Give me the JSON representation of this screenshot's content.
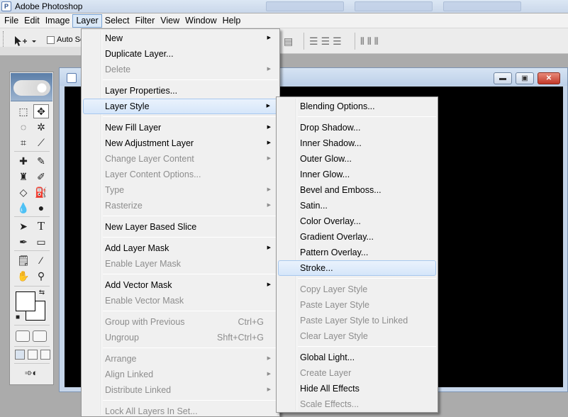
{
  "app": {
    "title": "Adobe Photoshop"
  },
  "menubar": [
    "File",
    "Edit",
    "Image",
    "Layer",
    "Select",
    "Filter",
    "View",
    "Window",
    "Help"
  ],
  "options": {
    "auto_select": "Auto Se"
  },
  "layer_menu": [
    {
      "label": "New",
      "submenu": true
    },
    {
      "label": "Duplicate Layer..."
    },
    {
      "label": "Delete",
      "disabled": true,
      "submenu": true
    },
    {
      "sep": true
    },
    {
      "label": "Layer Properties..."
    },
    {
      "label": "Layer Style",
      "submenu": true,
      "highlighted": true
    },
    {
      "sep": true
    },
    {
      "label": "New Fill Layer",
      "submenu": true
    },
    {
      "label": "New Adjustment Layer",
      "submenu": true
    },
    {
      "label": "Change Layer Content",
      "disabled": true,
      "submenu": true
    },
    {
      "label": "Layer Content Options...",
      "disabled": true
    },
    {
      "label": "Type",
      "disabled": true,
      "submenu": true
    },
    {
      "label": "Rasterize",
      "disabled": true,
      "submenu": true
    },
    {
      "sep": true
    },
    {
      "label": "New Layer Based Slice"
    },
    {
      "sep": true
    },
    {
      "label": "Add Layer Mask",
      "submenu": true
    },
    {
      "label": "Enable Layer Mask",
      "disabled": true
    },
    {
      "sep": true
    },
    {
      "label": "Add Vector Mask",
      "submenu": true
    },
    {
      "label": "Enable Vector Mask",
      "disabled": true
    },
    {
      "sep": true
    },
    {
      "label": "Group with Previous",
      "disabled": true,
      "shortcut": "Ctrl+G"
    },
    {
      "label": "Ungroup",
      "disabled": true,
      "shortcut": "Shft+Ctrl+G"
    },
    {
      "sep": true
    },
    {
      "label": "Arrange",
      "disabled": true,
      "submenu": true
    },
    {
      "label": "Align Linked",
      "disabled": true,
      "submenu": true
    },
    {
      "label": "Distribute Linked",
      "disabled": true,
      "submenu": true
    },
    {
      "sep": true
    },
    {
      "label": "Lock All Layers In Set...",
      "disabled": true
    }
  ],
  "style_menu": [
    {
      "label": "Blending Options..."
    },
    {
      "sep": true
    },
    {
      "label": "Drop Shadow..."
    },
    {
      "label": "Inner Shadow..."
    },
    {
      "label": "Outer Glow..."
    },
    {
      "label": "Inner Glow..."
    },
    {
      "label": "Bevel and Emboss..."
    },
    {
      "label": "Satin..."
    },
    {
      "label": "Color Overlay..."
    },
    {
      "label": "Gradient Overlay..."
    },
    {
      "label": "Pattern Overlay..."
    },
    {
      "label": "Stroke...",
      "highlighted": true
    },
    {
      "sep": true
    },
    {
      "label": "Copy Layer Style",
      "disabled": true
    },
    {
      "label": "Paste Layer Style",
      "disabled": true
    },
    {
      "label": "Paste Layer Style to Linked",
      "disabled": true
    },
    {
      "label": "Clear Layer Style",
      "disabled": true
    },
    {
      "sep": true
    },
    {
      "label": "Global Light..."
    },
    {
      "label": "Create Layer",
      "disabled": true
    },
    {
      "label": "Hide All Effects"
    },
    {
      "label": "Scale Effects...",
      "disabled": true
    }
  ],
  "colors": {
    "canvas": "#000000",
    "menu_bg": "#f0f0f0",
    "highlight": "#d5e6fa"
  }
}
